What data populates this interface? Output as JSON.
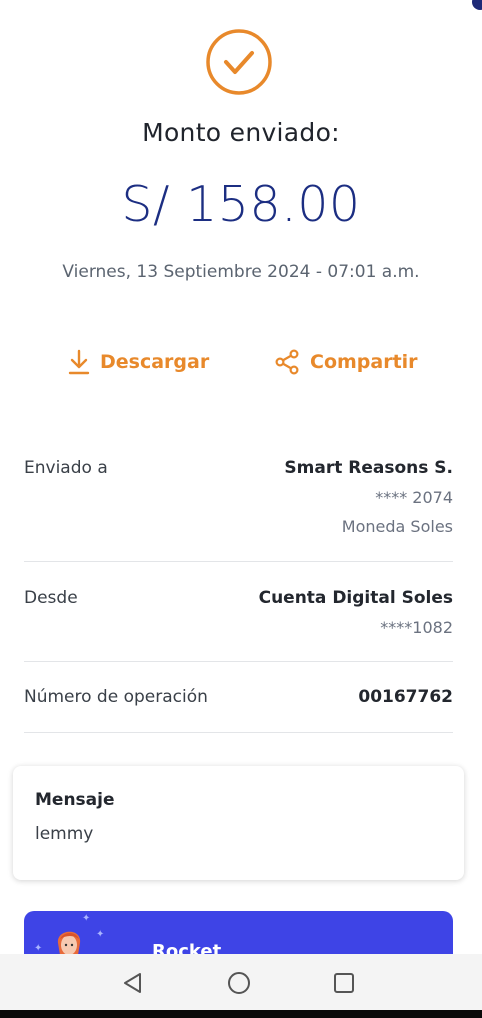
{
  "colors": {
    "accent": "#e8892b",
    "brand_blue": "#1c2e82",
    "promo_blue": "#3e44e6"
  },
  "header": {
    "icon": "check-circle-icon",
    "title": "Monto enviado:",
    "amount": "S/ 158.00",
    "date": "Viernes, 13 Septiembre 2024 - 07:01 a.m."
  },
  "actions": {
    "download": {
      "icon": "download-icon",
      "label": "Descargar"
    },
    "share": {
      "icon": "share-icon",
      "label": "Compartir"
    }
  },
  "details": {
    "sent_to": {
      "label": "Enviado a",
      "name": "Smart Reasons S.",
      "account": "**** 2074",
      "currency": "Moneda Soles"
    },
    "from": {
      "label": "Desde",
      "account_name": "Cuenta Digital Soles",
      "account": "****1082"
    },
    "operation": {
      "label": "Número de operación",
      "number": "00167762"
    }
  },
  "message": {
    "title": "Mensaje",
    "body": "lemmy"
  },
  "promo": {
    "text": "Rocket"
  },
  "navbar": {
    "back": "back-triangle-icon",
    "home": "home-circle-icon",
    "recents": "recents-square-icon"
  }
}
